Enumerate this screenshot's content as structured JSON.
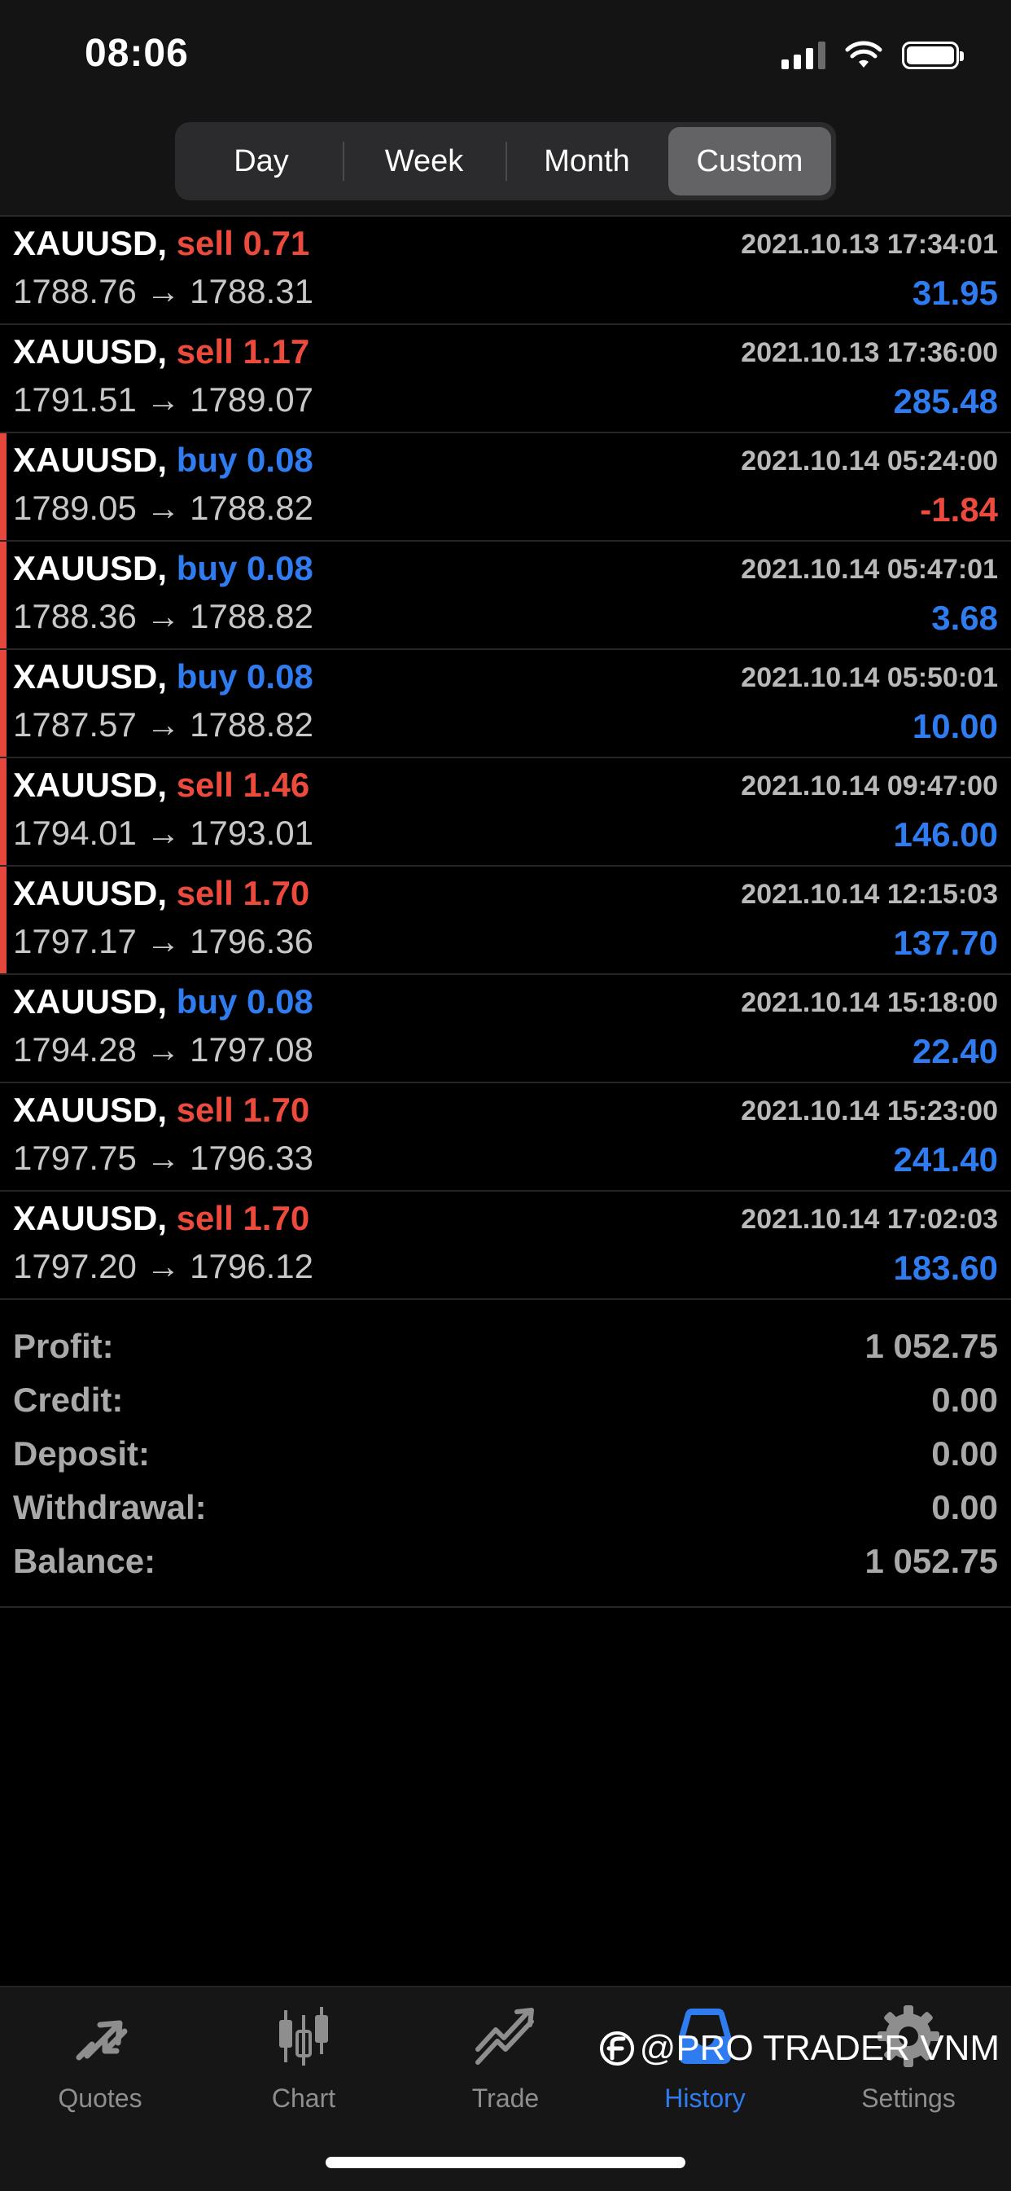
{
  "status": {
    "time": "08:06"
  },
  "periods": [
    "Day",
    "Week",
    "Month",
    "Custom"
  ],
  "active_period": "Custom",
  "deals": [
    {
      "symbol": "XAUUSD,",
      "side": "sell",
      "volume": "0.71",
      "open": "1788.76",
      "close": "1788.31",
      "time": "2021.10.13 17:34:01",
      "profit": "31.95",
      "marked": false
    },
    {
      "symbol": "XAUUSD,",
      "side": "sell",
      "volume": "1.17",
      "open": "1791.51",
      "close": "1789.07",
      "time": "2021.10.13 17:36:00",
      "profit": "285.48",
      "marked": false
    },
    {
      "symbol": "XAUUSD,",
      "side": "buy",
      "volume": "0.08",
      "open": "1789.05",
      "close": "1788.82",
      "time": "2021.10.14 05:24:00",
      "profit": "-1.84",
      "marked": true
    },
    {
      "symbol": "XAUUSD,",
      "side": "buy",
      "volume": "0.08",
      "open": "1788.36",
      "close": "1788.82",
      "time": "2021.10.14 05:47:01",
      "profit": "3.68",
      "marked": true
    },
    {
      "symbol": "XAUUSD,",
      "side": "buy",
      "volume": "0.08",
      "open": "1787.57",
      "close": "1788.82",
      "time": "2021.10.14 05:50:01",
      "profit": "10.00",
      "marked": true
    },
    {
      "symbol": "XAUUSD,",
      "side": "sell",
      "volume": "1.46",
      "open": "1794.01",
      "close": "1793.01",
      "time": "2021.10.14 09:47:00",
      "profit": "146.00",
      "marked": true
    },
    {
      "symbol": "XAUUSD,",
      "side": "sell",
      "volume": "1.70",
      "open": "1797.17",
      "close": "1796.36",
      "time": "2021.10.14 12:15:03",
      "profit": "137.70",
      "marked": true
    },
    {
      "symbol": "XAUUSD,",
      "side": "buy",
      "volume": "0.08",
      "open": "1794.28",
      "close": "1797.08",
      "time": "2021.10.14 15:18:00",
      "profit": "22.40",
      "marked": false
    },
    {
      "symbol": "XAUUSD,",
      "side": "sell",
      "volume": "1.70",
      "open": "1797.75",
      "close": "1796.33",
      "time": "2021.10.14 15:23:00",
      "profit": "241.40",
      "marked": false
    },
    {
      "symbol": "XAUUSD,",
      "side": "sell",
      "volume": "1.70",
      "open": "1797.20",
      "close": "1796.12",
      "time": "2021.10.14 17:02:03",
      "profit": "183.60",
      "marked": false
    }
  ],
  "arrow": "→",
  "summary": [
    {
      "label": "Profit:",
      "value": "1 052.75"
    },
    {
      "label": "Credit:",
      "value": "0.00"
    },
    {
      "label": "Deposit:",
      "value": "0.00"
    },
    {
      "label": "Withdrawal:",
      "value": "0.00"
    },
    {
      "label": "Balance:",
      "value": "1 052.75"
    }
  ],
  "tabs": [
    {
      "label": "Quotes",
      "icon": "quotes-icon",
      "active": false
    },
    {
      "label": "Chart",
      "icon": "chart-icon",
      "active": false
    },
    {
      "label": "Trade",
      "icon": "trade-icon",
      "active": false
    },
    {
      "label": "History",
      "icon": "history-icon",
      "active": true
    },
    {
      "label": "Settings",
      "icon": "settings-icon",
      "active": false
    }
  ],
  "watermark": "@PRO TRADER VNM",
  "colors": {
    "sell": "#ec4a3c",
    "buy": "#2f7cf0",
    "active_tab": "#2f7cf0",
    "marker": "#e5473c"
  }
}
